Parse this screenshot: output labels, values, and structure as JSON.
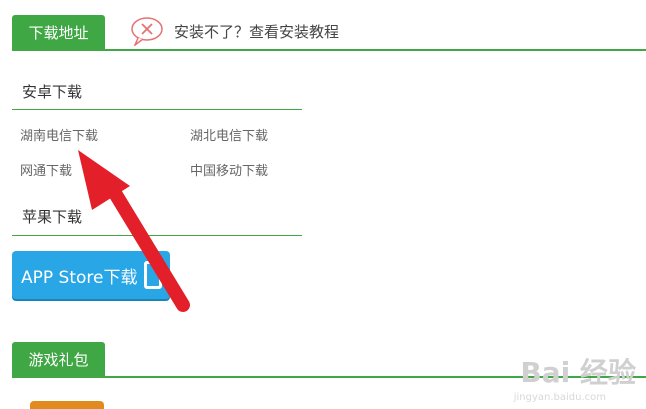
{
  "header": {
    "tab_label": "下载地址",
    "help_text": "安装不了？查看安装教程"
  },
  "android": {
    "title": "安卓下载",
    "links": [
      "湖南电信下载",
      "湖北电信下载",
      "网通下载",
      "中国移动下载"
    ]
  },
  "ios": {
    "title": "苹果下载",
    "button_label": "APP Store下载"
  },
  "gift": {
    "tab_label": "游戏礼包"
  },
  "watermark": {
    "text": "Bai 经验",
    "sub": "jingyan.baidu.com"
  },
  "colors": {
    "green": "#3fa744",
    "blue": "#29a6e6",
    "arrow": "#e3202a"
  }
}
